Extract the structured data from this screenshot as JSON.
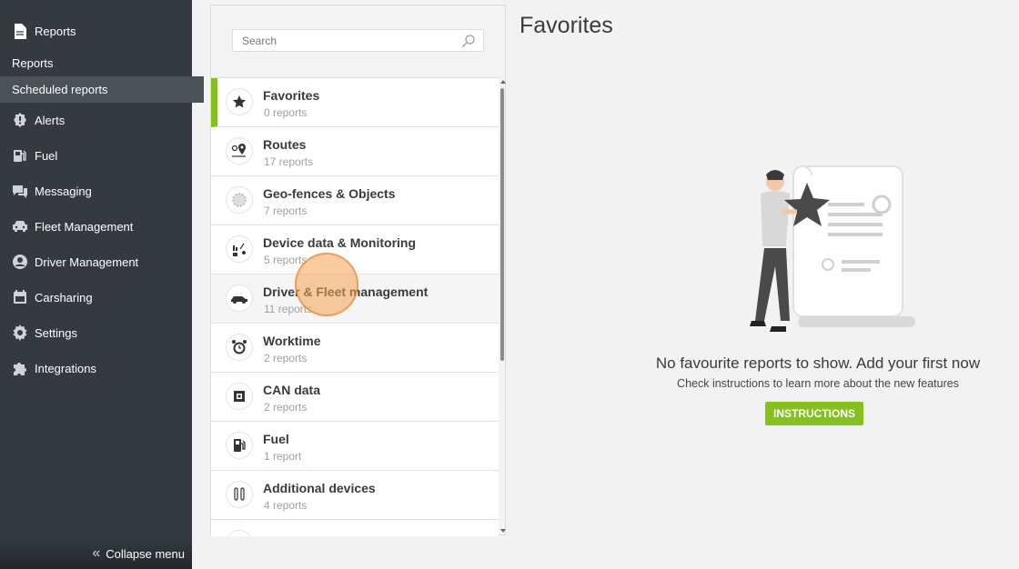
{
  "sidebar": {
    "reports_label": "Reports",
    "sub_reports": "Reports",
    "sub_scheduled": "Scheduled reports",
    "items": [
      {
        "label": "Alerts",
        "icon": "alert-icon"
      },
      {
        "label": "Fuel",
        "icon": "fuel-icon"
      },
      {
        "label": "Messaging",
        "icon": "messaging-icon"
      },
      {
        "label": "Fleet Management",
        "icon": "car-icon"
      },
      {
        "label": "Driver Management",
        "icon": "user-icon"
      },
      {
        "label": "Carsharing",
        "icon": "calendar-icon"
      },
      {
        "label": "Settings",
        "icon": "gear-icon"
      },
      {
        "label": "Integrations",
        "icon": "puzzle-icon"
      }
    ],
    "collapse_label": "Collapse menu"
  },
  "search": {
    "placeholder": "Search"
  },
  "categories": [
    {
      "title": "Favorites",
      "count": "0 reports",
      "icon": "star-icon"
    },
    {
      "title": "Routes",
      "count": "17 reports",
      "icon": "map-pin-icon"
    },
    {
      "title": "Geo-fences & Objects",
      "count": "7 reports",
      "icon": "geofence-icon"
    },
    {
      "title": "Device data & Monitoring",
      "count": "5 reports",
      "icon": "device-icon"
    },
    {
      "title": "Driver & Fleet management",
      "count": "11 reports",
      "icon": "fleet-car-icon"
    },
    {
      "title": "Worktime",
      "count": "2 reports",
      "icon": "clock-icon"
    },
    {
      "title": "CAN data",
      "count": "2 reports",
      "icon": "chip-icon"
    },
    {
      "title": "Fuel",
      "count": "1 report",
      "icon": "fuel-pump-icon"
    },
    {
      "title": "Additional devices",
      "count": "4 reports",
      "icon": "sensor-icon"
    }
  ],
  "main": {
    "title": "Favorites",
    "empty_title": "No favourite reports to show. Add your first now",
    "empty_subtitle": "Check instructions to learn more about the new features",
    "instructions_button": "INSTRUCTIONS"
  },
  "colors": {
    "accent": "#84c11f",
    "sidebar_bg": "#343a40"
  }
}
